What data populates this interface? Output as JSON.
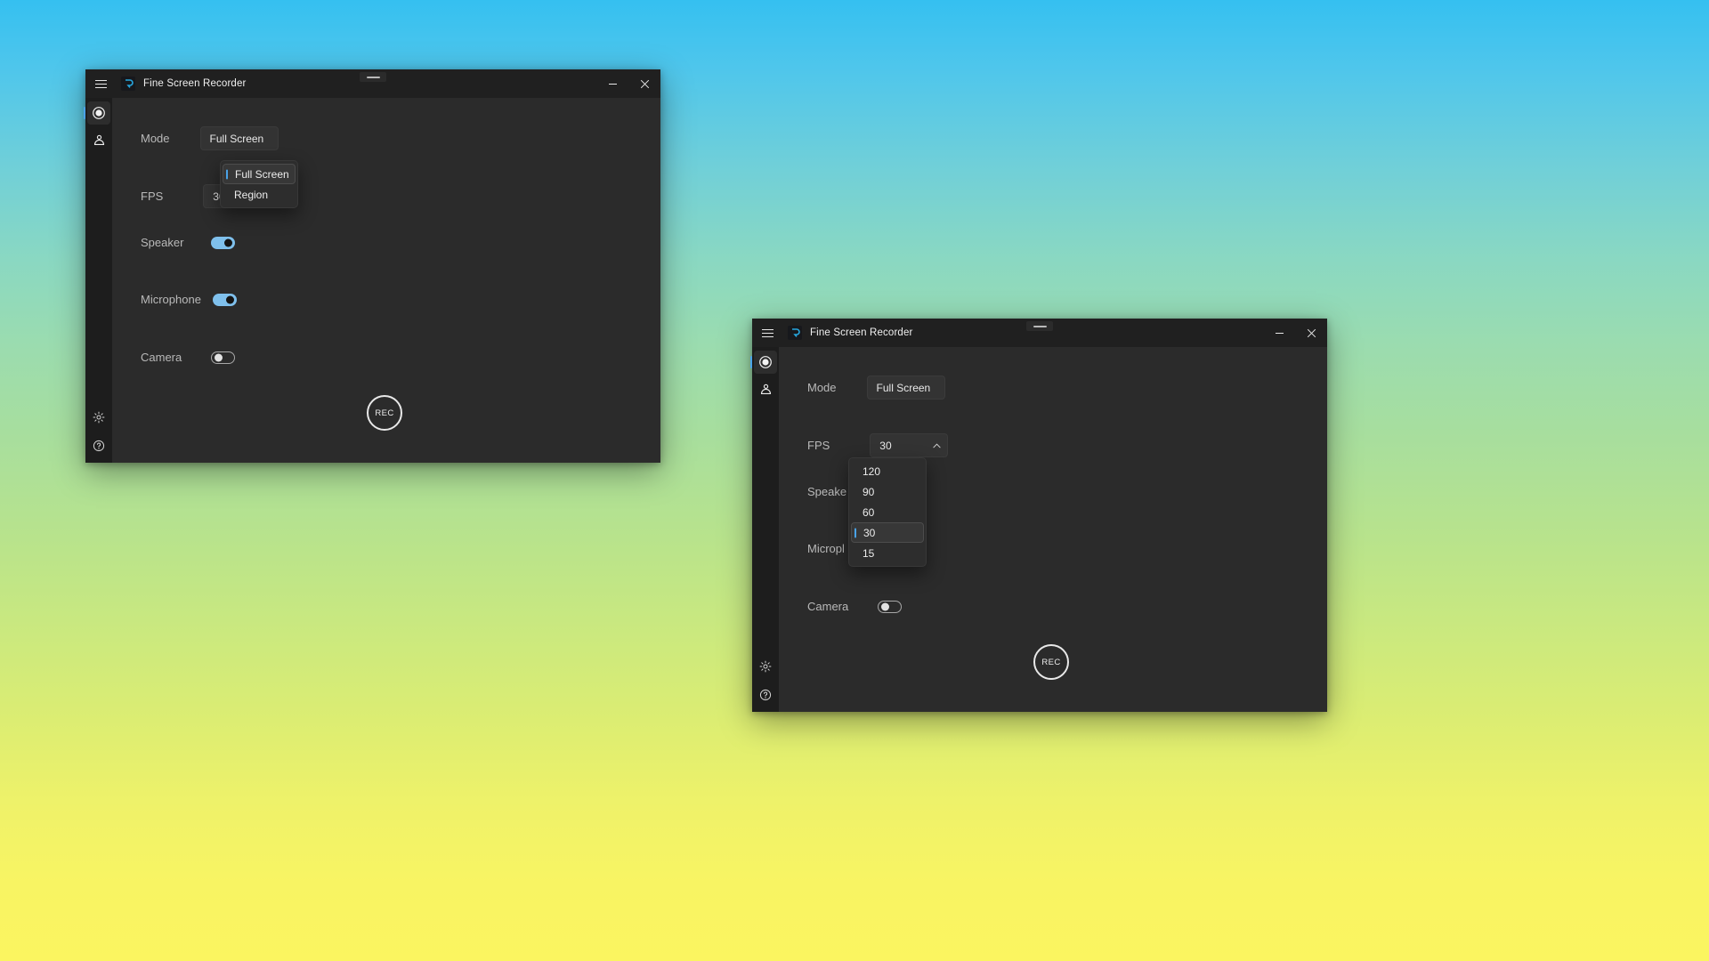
{
  "desktop": {
    "background_gradient_top": "#35c0f0",
    "background_gradient_mid": "#a7de9e",
    "background_gradient_bottom": "#fbf560"
  },
  "accent_color": "#4aa3e8",
  "toggle_on_color": "#7fc0ec",
  "window1": {
    "title": "Fine Screen Recorder",
    "titlebar": {
      "menu_icon": "hamburger-icon",
      "app_icon": "app-logo-icon",
      "minimize_label": "—",
      "close_label": "✕"
    },
    "sidebar": {
      "items": [
        {
          "name": "record",
          "icon": "record-circle-icon",
          "active": true
        },
        {
          "name": "account",
          "icon": "person-icon",
          "active": false
        }
      ],
      "bottom_items": [
        {
          "name": "settings",
          "icon": "gear-icon"
        },
        {
          "name": "help",
          "icon": "question-circle-icon"
        }
      ]
    },
    "mode": {
      "label": "Mode",
      "value": "Full Screen",
      "expanded": true,
      "chevron": "chevron-up-icon",
      "options": [
        {
          "label": "Full Screen",
          "selected": true
        },
        {
          "label": "Region",
          "selected": false
        }
      ]
    },
    "fps": {
      "label": "FPS",
      "value": "30",
      "expanded": false
    },
    "speaker": {
      "label": "Speaker",
      "state": "on"
    },
    "microphone": {
      "label": "Microphone",
      "state": "on"
    },
    "camera": {
      "label": "Camera",
      "state": "off"
    },
    "record_button": {
      "label": "REC"
    }
  },
  "window2": {
    "title": "Fine Screen Recorder",
    "titlebar": {
      "menu_icon": "hamburger-icon",
      "app_icon": "app-logo-icon",
      "minimize_label": "—",
      "close_label": "✕"
    },
    "sidebar": {
      "items": [
        {
          "name": "record",
          "icon": "record-circle-icon",
          "active": true
        },
        {
          "name": "account",
          "icon": "person-icon",
          "active": false
        }
      ],
      "bottom_items": [
        {
          "name": "settings",
          "icon": "gear-icon"
        },
        {
          "name": "help",
          "icon": "question-circle-icon"
        }
      ]
    },
    "mode": {
      "label": "Mode",
      "value": "Full Screen",
      "expanded": false,
      "chevron": "chevron-down-icon"
    },
    "fps": {
      "label": "FPS",
      "value": "30",
      "expanded": true,
      "chevron": "chevron-up-icon",
      "options": [
        {
          "label": "120",
          "selected": false
        },
        {
          "label": "90",
          "selected": false
        },
        {
          "label": "60",
          "selected": false
        },
        {
          "label": "30",
          "selected": true
        },
        {
          "label": "15",
          "selected": false
        }
      ]
    },
    "speaker": {
      "label": "Speake",
      "state": "on"
    },
    "microphone": {
      "label": "Micropl",
      "state": "on"
    },
    "camera": {
      "label": "Camera",
      "state": "off"
    },
    "record_button": {
      "label": "REC"
    }
  }
}
